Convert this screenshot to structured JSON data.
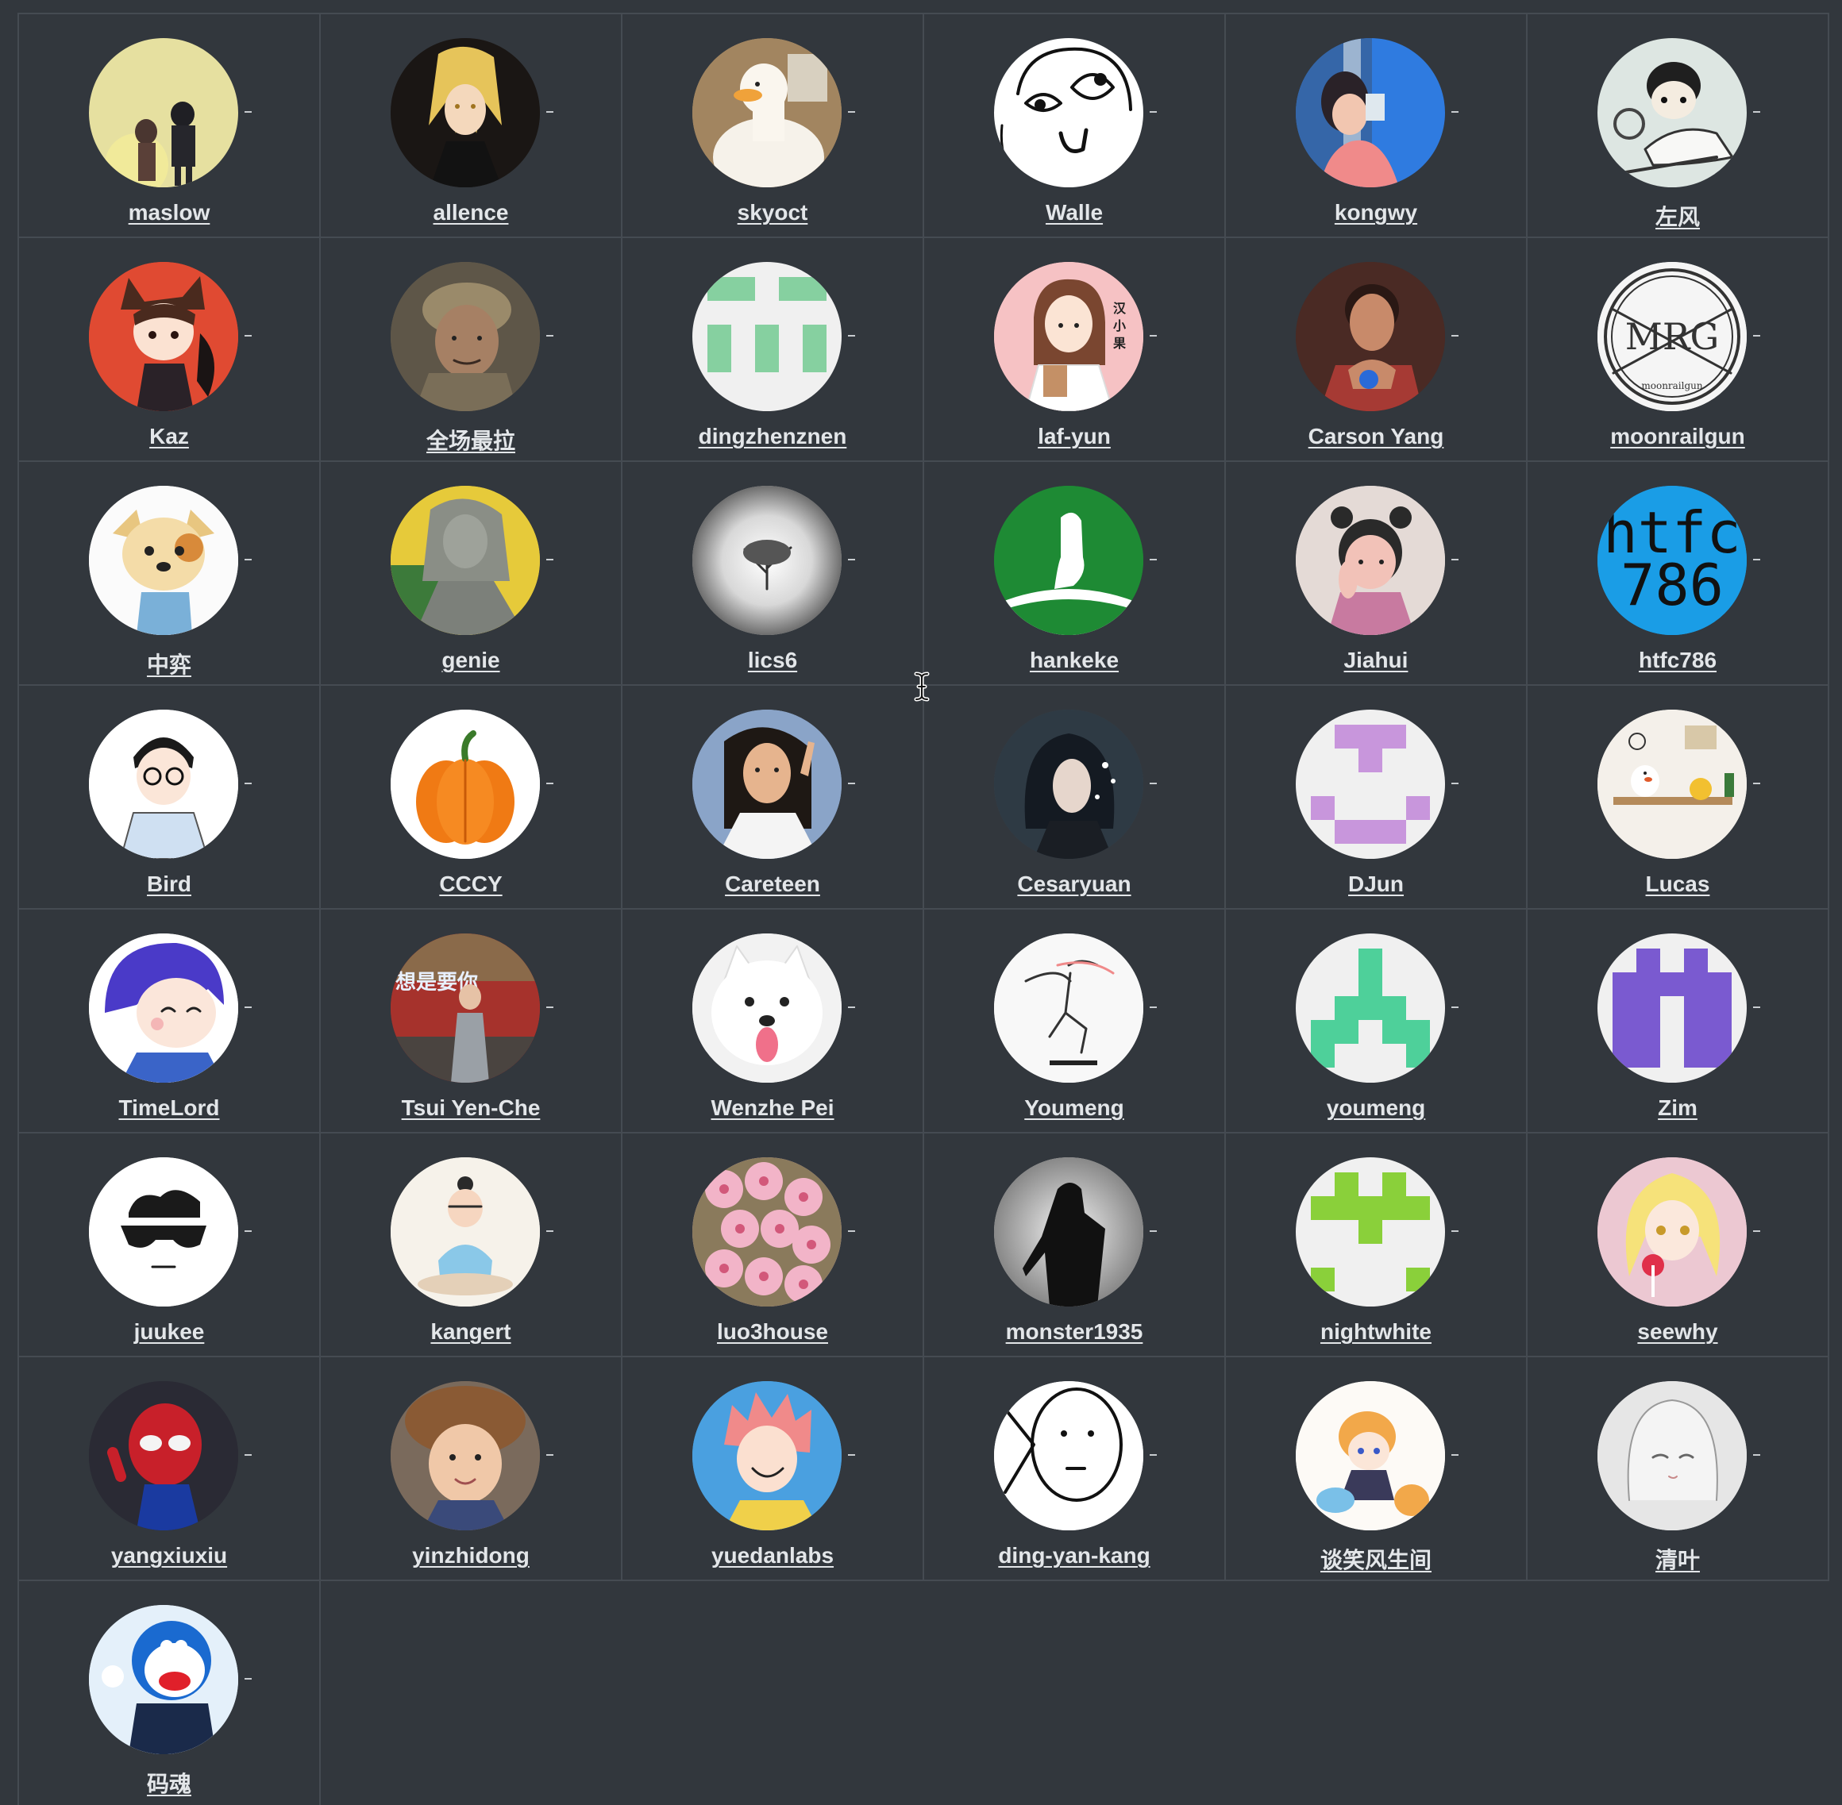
{
  "contributors": [
    {
      "name": "maslow",
      "icon": "walking-couple-avatar-icon",
      "bg": "#e6e0a0"
    },
    {
      "name": "allence",
      "icon": "blonde-anime-character-avatar-icon",
      "bg": "#2a2522"
    },
    {
      "name": "skyoct",
      "icon": "white-duck-avatar-icon",
      "bg": "#b89a70"
    },
    {
      "name": "Walle",
      "icon": "rage-face-meme-avatar-icon",
      "bg": "#ffffff"
    },
    {
      "name": "kongwy",
      "icon": "anime-girl-drinking-avatar-icon",
      "bg": "#2f7be0"
    },
    {
      "name": "左风",
      "icon": "cartoon-rider-avatar-icon",
      "bg": "#dde6e2"
    },
    {
      "name": "Kaz",
      "icon": "chibi-boy-red-avatar-icon",
      "bg": "#e04a32"
    },
    {
      "name": "全场最拉",
      "icon": "soldier-photo-avatar-icon",
      "bg": "#6e6450"
    },
    {
      "name": "dingzhenznen",
      "icon": "green-identicon-avatar-icon",
      "bg": "#f0f0f0"
    },
    {
      "name": "laf-yun",
      "icon": "cartoon-doctor-avatar-icon",
      "bg": "#f6bcc0"
    },
    {
      "name": "Carson Yang",
      "icon": "man-portrait-avatar-icon",
      "bg": "#4a2a22"
    },
    {
      "name": "moonrailgun",
      "icon": "mrg-logo-avatar-icon",
      "bg": "#f5f5f5"
    },
    {
      "name": "中弈",
      "icon": "cartoon-dog-avatar-icon",
      "bg": "#fbfbfb"
    },
    {
      "name": "genie",
      "icon": "statue-figure-avatar-icon",
      "bg": "#d4c040"
    },
    {
      "name": "lics6",
      "icon": "lone-tree-avatar-icon",
      "bg": "#bcbcbc"
    },
    {
      "name": "hankeke",
      "icon": "green-hand-logo-avatar-icon",
      "bg": "#1e8a34"
    },
    {
      "name": "Jiahui",
      "icon": "cartoon-girl-thinking-avatar-icon",
      "bg": "#e6dcd8"
    },
    {
      "name": "htfc786",
      "icon": "htfc786-text-avatar-icon",
      "bg": "#1a9de6"
    },
    {
      "name": "Bird",
      "icon": "cartoon-boy-glasses-avatar-icon",
      "bg": "#ffffff"
    },
    {
      "name": "CCCY",
      "icon": "pumpkin-avatar-icon",
      "bg": "#ffffff"
    },
    {
      "name": "Careteen",
      "icon": "girl-peace-sign-avatar-icon",
      "bg": "#8aa4c8"
    },
    {
      "name": "Cesaryuan",
      "icon": "anime-girl-dark-avatar-icon",
      "bg": "#3c4a55"
    },
    {
      "name": "DJun",
      "icon": "purple-identicon-avatar-icon",
      "bg": "#f0f0f0"
    },
    {
      "name": "Lucas",
      "icon": "cartoon-chick-room-avatar-icon",
      "bg": "#f4f0ea"
    },
    {
      "name": "TimeLord",
      "icon": "anime-boy-blue-hair-avatar-icon",
      "bg": "#ffffff"
    },
    {
      "name": "Tsui Yen-Che",
      "icon": "man-red-train-avatar-icon",
      "bg": "#a6322c"
    },
    {
      "name": "Wenzhe Pei",
      "icon": "samoyed-dog-avatar-icon",
      "bg": "#f2f2f2"
    },
    {
      "name": "Youmeng",
      "icon": "skateboarder-sketch-avatar-icon",
      "bg": "#f8f8f8"
    },
    {
      "name": "youmeng",
      "icon": "teal-identicon-avatar-icon",
      "bg": "#f0f0f0"
    },
    {
      "name": "Zim",
      "icon": "indigo-identicon-avatar-icon",
      "bg": "#f0f0f0"
    },
    {
      "name": "juukee",
      "icon": "sunglasses-face-avatar-icon",
      "bg": "#ffffff"
    },
    {
      "name": "kangert",
      "icon": "meditating-girl-avatar-icon",
      "bg": "#f6f2ea"
    },
    {
      "name": "luo3house",
      "icon": "cherry-blossom-avatar-icon",
      "bg": "#e8b6c4"
    },
    {
      "name": "monster1935",
      "icon": "soldier-silhouette-avatar-icon",
      "bg": "#cfcfcf"
    },
    {
      "name": "nightwhite",
      "icon": "lime-identicon-avatar-icon",
      "bg": "#f0f0f0"
    },
    {
      "name": "seewhy",
      "icon": "anime-girl-candy-avatar-icon",
      "bg": "#ecc8d2"
    },
    {
      "name": "yangxiuxiu",
      "icon": "spiderman-avatar-icon",
      "bg": "#2a2a34"
    },
    {
      "name": "yinzhidong",
      "icon": "baby-fluffy-hair-avatar-icon",
      "bg": "#7a6a5c"
    },
    {
      "name": "yuedanlabs",
      "icon": "anime-boy-pink-hair-avatar-icon",
      "bg": "#4aa0e0"
    },
    {
      "name": "ding-yan-kang",
      "icon": "meme-face-sketch-avatar-icon",
      "bg": "#ffffff"
    },
    {
      "name": "谈笑风生间",
      "icon": "chibi-character-cat-avatar-icon",
      "bg": "#fdfaf6"
    },
    {
      "name": "清叶",
      "icon": "anime-girl-sketch-avatar-icon",
      "bg": "#e6e6e6"
    },
    {
      "name": "码魂",
      "icon": "doraemon-suit-avatar-icon",
      "bg": "#e4f0fa"
    }
  ],
  "dash_glyph": "–"
}
